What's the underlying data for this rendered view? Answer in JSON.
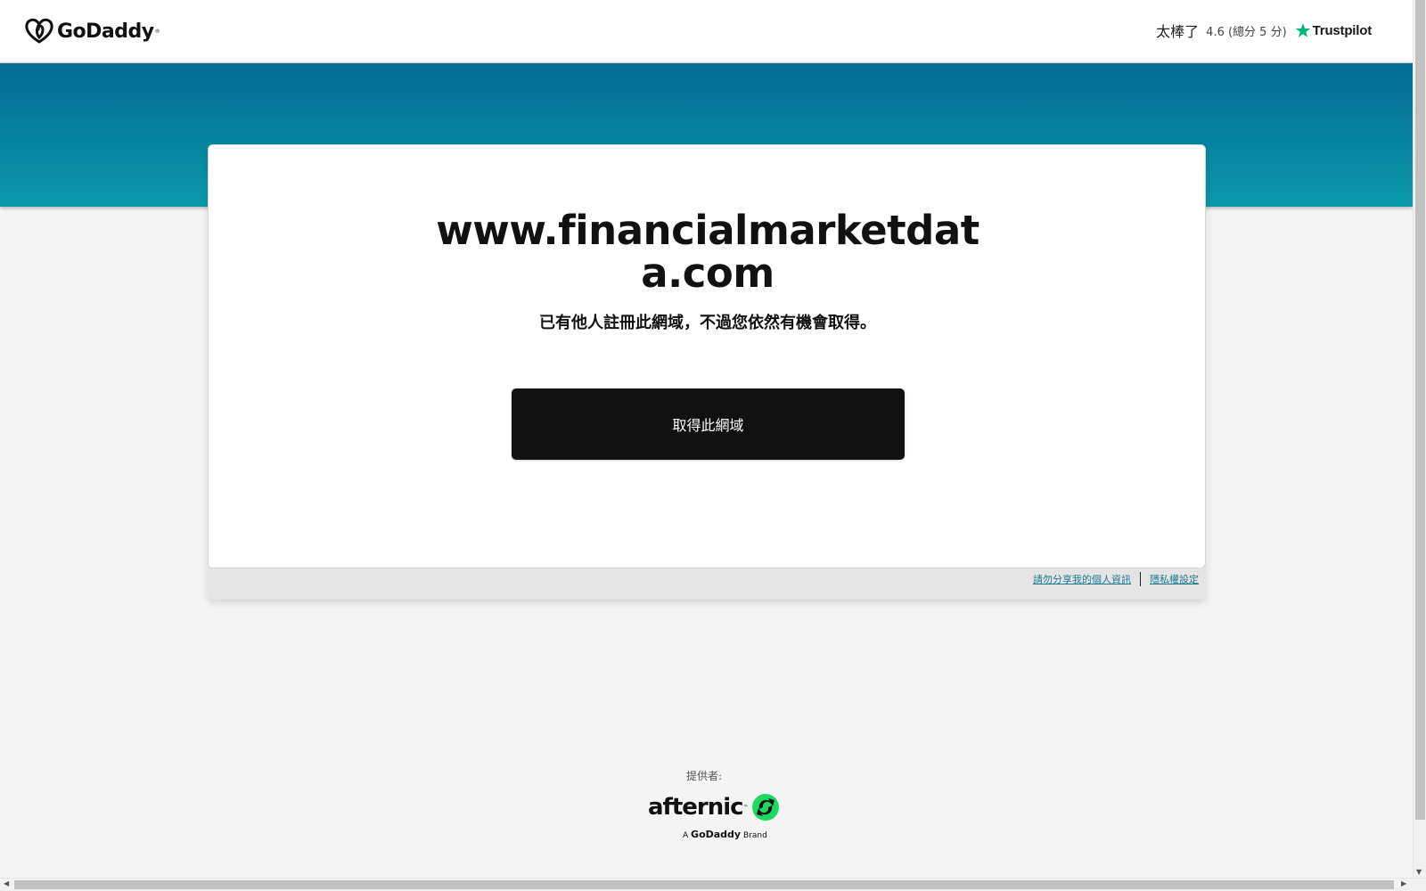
{
  "header": {
    "logo_text": "GoDaddy",
    "logo_tm": "®",
    "rating_word": "太棒了",
    "rating_score": "4.6 (總分 5 分)",
    "trustpilot_label": "Trustpilot"
  },
  "main": {
    "domain": "www.financialmarketdata.com",
    "subtitle": "已有他人註冊此網域，不過您依然有機會取得。",
    "cta_label": "取得此網域"
  },
  "footer_links": {
    "do_not_share": "請勿分享我的個人資訊",
    "privacy_settings": "隱私權設定"
  },
  "provider": {
    "label": "提供者:",
    "brand": "afternic",
    "brand_tm": "™",
    "tagline_prefix": "A",
    "tagline_brand": "GoDaddy",
    "tagline_suffix": "Brand"
  },
  "colors": {
    "banner_top": "#036c92",
    "banner_bottom": "#0b98ab",
    "cta_bg": "#111111",
    "link": "#1f7a8c",
    "trustpilot_green": "#00b67a",
    "afternic_green": "#1ed760"
  },
  "icons": {
    "logo": "godaddy-heart-icon",
    "trustpilot": "star-icon",
    "afternic": "afternic-arrows-icon"
  }
}
